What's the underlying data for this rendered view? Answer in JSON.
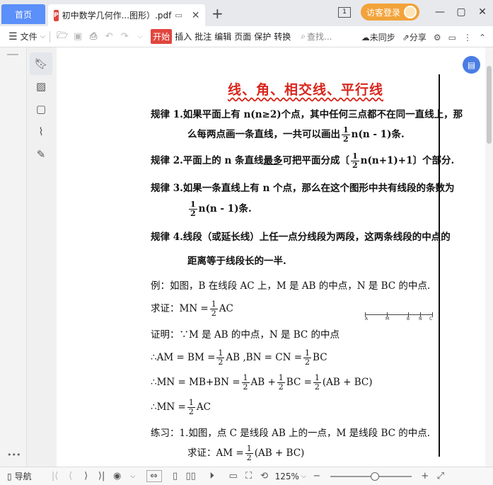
{
  "tabs": {
    "home_label": "首页",
    "doc_title": "初中数学几何作...图形）.pdf",
    "close_glyph": "✕",
    "new_tab_glyph": "+"
  },
  "window": {
    "page_badge": "1",
    "login_label": "访客登录",
    "min_glyph": "—",
    "max_glyph": "▢",
    "close_glyph": "✕"
  },
  "toolbar": {
    "file_label": "文件",
    "kaishi_label": "开始",
    "insert_label": "插入",
    "annotate_label": "批注",
    "edit_label": "编辑",
    "page_label": "页面",
    "protect_label": "保护",
    "convert_label": "转换",
    "search_placeholder": "查找...",
    "sync_label": "未同步",
    "share_label": "分享"
  },
  "document": {
    "title": "线、角、相交线、平行线",
    "rule1_a": "规律 1.如果平面上有 n(n≥2)个点，其中任何三点都不在同一直线上，那",
    "rule1_b_pre": "么每两点画一条直线，一共可以画出",
    "rule1_b_post": "n(n - 1)条.",
    "rule2_pre": "规律 2.平面上的 n 条直线",
    "rule2_under": "最多",
    "rule2_mid": "可把平面分成〔",
    "rule2_post": "n(n+1)+1〕个部分.",
    "rule3_a": "规律 3.如果一条直线上有 n 个点，那么在这个图形中共有线段的条数为",
    "rule3_b": "n(n - 1)条.",
    "rule4_a": "规律 4.线段（或延长线）上任一点分线段为两段，这两条线段的中点的",
    "rule4_b": "距离等于线段长的一半.",
    "example": "例：如图，B 在线段 AC 上，M 是 AB 的中点，N 是 BC 的中点.",
    "prove_pre": "求证：MN =",
    "prove_post": "AC",
    "proof1": "证明：∵M 是 AB 的中点，N 是 BC 的中点",
    "proof2_pre": "∴AM = BM =",
    "proof2_mid": "AB ,BN = CN =",
    "proof2_post": "BC",
    "proof3_pre": "∴MN = MB+BN =",
    "proof3_mid1": "AB +",
    "proof3_mid2": "BC =",
    "proof3_post": "(AB + BC)",
    "proof4_pre": "∴MN =",
    "proof4_post": "AC",
    "practice": "练习：1.如图，点 C 是线段 AB 上的一点，M 是线段 BC 的中点.",
    "practice_prove_pre": "求证：AM =",
    "practice_prove_post": "(AB + BC)",
    "half_num": "1",
    "half_den": "2",
    "segment_labels": [
      "A",
      "M",
      "B",
      "N",
      "C"
    ]
  },
  "statusbar": {
    "nav_label": "导航",
    "zoom_label": "125%",
    "zoom_fraction": 0.55
  },
  "colors": {
    "accent": "#5b8ff9",
    "title_red": "#d8261d",
    "login_orange": "#f2a33a",
    "kaishi_red": "#e0463e"
  }
}
